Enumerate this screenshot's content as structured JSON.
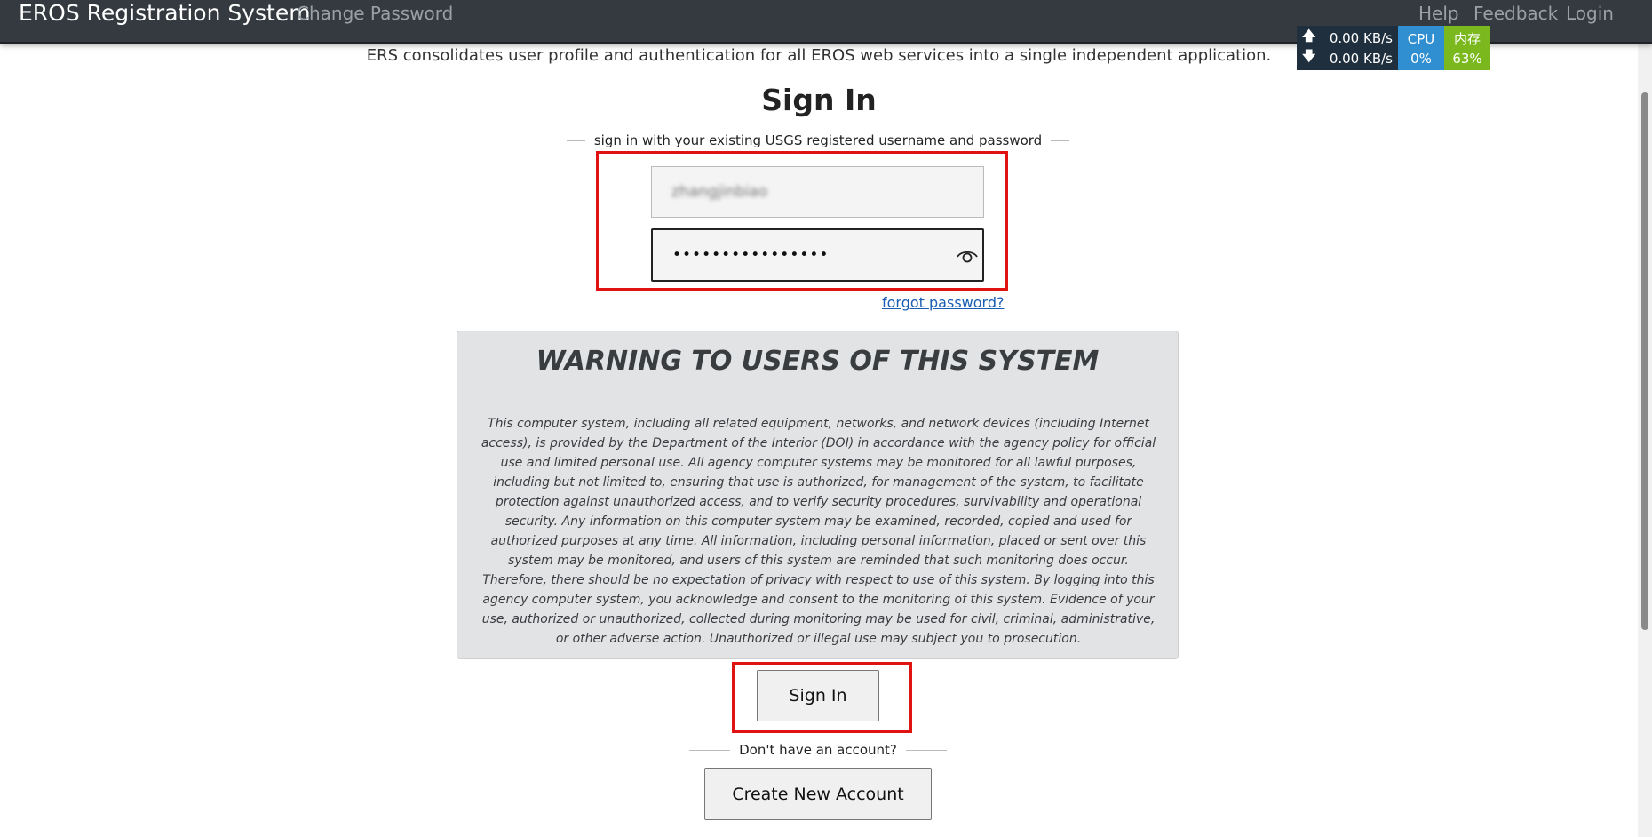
{
  "navbar": {
    "brand": "EROS Registration System",
    "change_password": "Change Password",
    "help": "Help",
    "feedback": "Feedback",
    "login": "Login"
  },
  "netmon": {
    "upload_arrow": "🡅",
    "download_arrow": "🡇",
    "upload": "0.00 KB/s",
    "download": "0.00 KB/s",
    "cpu_label": "CPU",
    "cpu_value": "0%",
    "mem_label": "内存",
    "mem_value": "63%"
  },
  "intro": "ERS consolidates user profile and authentication for all EROS web services into a single independent application.",
  "signin": {
    "title": "Sign In",
    "subtitle": "sign in with your existing USGS registered username and password",
    "username_value": "zhangjinbiao",
    "password_mask": "••••••••••••••••",
    "forgot_label": "forgot password?",
    "button_label": "Sign In"
  },
  "warning": {
    "title": "WARNING TO USERS OF THIS SYSTEM",
    "body": "This computer system, including all related equipment, networks, and network devices (including Internet access), is provided by the Department of the Interior (DOI) in accordance with the agency policy for official use and limited personal use. All agency computer systems may be monitored for all lawful purposes, including but not limited to, ensuring that use is authorized, for management of the system, to facilitate protection against unauthorized access, and to verify security procedures, survivability and operational security. Any information on this computer system may be examined, recorded, copied and used for authorized purposes at any time. All information, including personal information, placed or sent over this system may be monitored, and users of this system are reminded that such monitoring does occur. Therefore, there should be no expectation of privacy with respect to use of this system. By logging into this agency computer system, you acknowledge and consent to the monitoring of this system. Evidence of your use, authorized or unauthorized, collected during monitoring may be used for civil, criminal, administrative, or other adverse action. Unauthorized or illegal use may subject you to prosecution."
  },
  "account": {
    "prompt": "Don't have an account?",
    "create_label": "Create New Account"
  },
  "colors": {
    "navbar_bg": "#343a40",
    "highlight": "#e01212",
    "link": "#1a5fb4",
    "warning_bg": "#e2e3e5"
  }
}
